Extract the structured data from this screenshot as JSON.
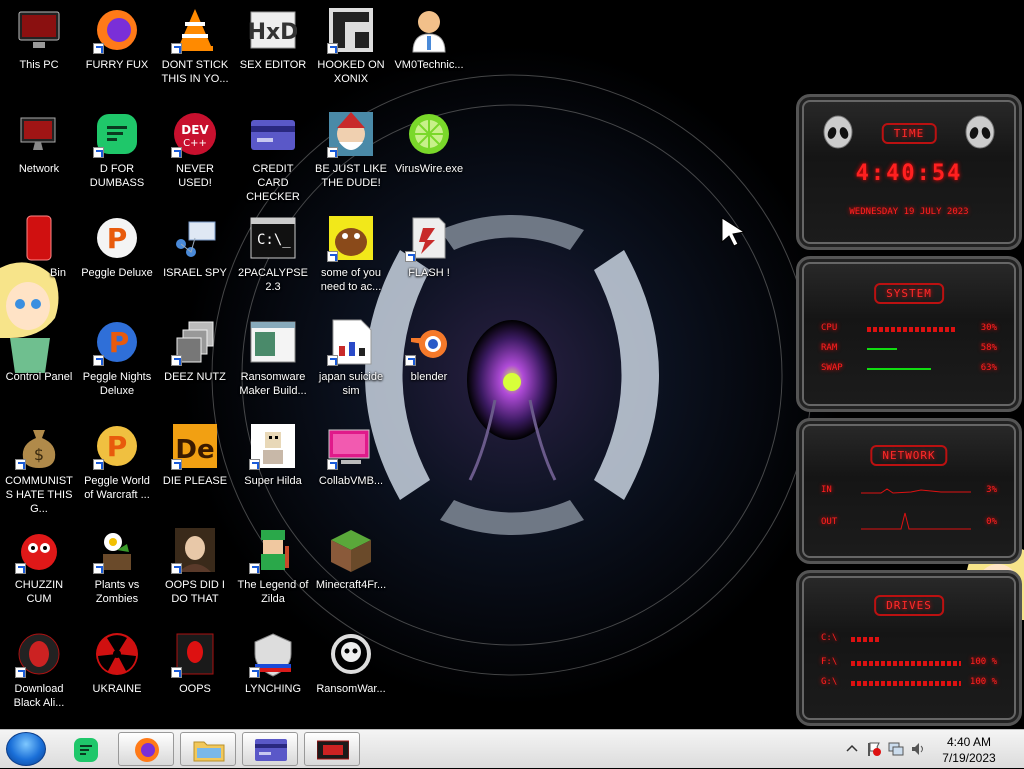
{
  "desktop": {
    "icons": [
      {
        "label": "This PC",
        "icon": "computer-icon"
      },
      {
        "label": "Network",
        "icon": "network-icon"
      },
      {
        "label": "Bin",
        "icon": "recycle-bin-icon"
      },
      {
        "label": "Control Panel",
        "icon": "control-panel-icon"
      },
      {
        "label": "COMMUNISTS HATE THIS G...",
        "icon": "money-bag-icon"
      },
      {
        "label": "CHUZZIN CUM",
        "icon": "chuzzle-icon"
      },
      {
        "label": "Download Black Ali...",
        "icon": "alien-icon"
      },
      {
        "label": "FURRY FUX",
        "icon": "firefox-icon"
      },
      {
        "label": "D FOR DUMBASS",
        "icon": "chat-app-icon"
      },
      {
        "label": "Peggle Deluxe",
        "icon": "peggle-icon"
      },
      {
        "label": "Peggle Nights Deluxe",
        "icon": "peggle-nights-icon"
      },
      {
        "label": "Peggle World of Warcraft ...",
        "icon": "peggle-wow-icon"
      },
      {
        "label": "Plants vs Zombies",
        "icon": "plants-icon"
      },
      {
        "label": "UKRAINE",
        "icon": "radiation-icon"
      },
      {
        "label": "DONT STICK THIS IN YO...",
        "icon": "vlc-icon"
      },
      {
        "label": "NEVER USED!",
        "icon": "dev-cpp-icon"
      },
      {
        "label": "ISRAEL SPY",
        "icon": "network-share-icon"
      },
      {
        "label": "DEEZ NUTZ",
        "icon": "windows-stack-icon"
      },
      {
        "label": "DIE PLEASE",
        "icon": "de-icon"
      },
      {
        "label": "OOPS DID I DO THAT",
        "icon": "portrait-icon"
      },
      {
        "label": "OOPS",
        "icon": "alienware-icon"
      },
      {
        "label": "SEX EDITOR",
        "icon": "hxd-icon"
      },
      {
        "label": "CREDIT CARD CHECKER",
        "icon": "credit-card-icon"
      },
      {
        "label": "2PACALYPSE 2.3",
        "icon": "terminal-icon"
      },
      {
        "label": "Ransomware Maker Build...",
        "icon": "app-window-icon"
      },
      {
        "label": "Super Hilda",
        "icon": "pixel-art-icon"
      },
      {
        "label": "The Legend of Zilda",
        "icon": "zelda-icon"
      },
      {
        "label": "LYNCHING",
        "icon": "bell-shield-icon"
      },
      {
        "label": "HOOKED ON XONIX",
        "icon": "xonix-icon"
      },
      {
        "label": "BE JUST LIKE THE DUDE!",
        "icon": "elf-icon"
      },
      {
        "label": "some of you need to ac...",
        "icon": "beaver-icon"
      },
      {
        "label": "japan suicide sim",
        "icon": "document-icon"
      },
      {
        "label": "CollabVMB...",
        "icon": "collabvm-icon"
      },
      {
        "label": "Minecraft4Fr...",
        "icon": "minecraft-icon"
      },
      {
        "label": "RansomWar...",
        "icon": "skull-icon"
      },
      {
        "label": "VM0Technic...",
        "icon": "doctor-icon"
      },
      {
        "label": "VirusWire.exe",
        "icon": "limewire-icon"
      },
      {
        "label": "FLASH !",
        "icon": "flash-icon"
      },
      {
        "label": "blender",
        "icon": "blender-icon"
      }
    ]
  },
  "widgets": {
    "time": {
      "title": "TIME",
      "clock": "4:40:54",
      "date": "WEDNESDAY 19 JULY 2023"
    },
    "system": {
      "title": "SYSTEM",
      "rows": [
        {
          "key": "CPU",
          "value": "30%",
          "level": 0.9
        },
        {
          "key": "RAM",
          "value": "58%",
          "level": 0.58
        },
        {
          "key": "SWAP",
          "value": "63%",
          "level": 0.63
        }
      ]
    },
    "network": {
      "title": "NETWORK",
      "rows": [
        {
          "key": "IN",
          "value": "3%"
        },
        {
          "key": "OUT",
          "value": "0%"
        }
      ]
    },
    "drives": {
      "title": "DRIVES",
      "rows": [
        {
          "key": "C:\\",
          "value": ""
        },
        {
          "key": "F:\\",
          "value": "100 %"
        },
        {
          "key": "G:\\",
          "value": "100 %"
        }
      ]
    }
  },
  "taskbar": {
    "items": [
      {
        "name": "D FOR DUMBASS",
        "icon": "chat-app-icon"
      },
      {
        "name": "FURRY FUX",
        "icon": "firefox-icon"
      },
      {
        "name": "File Explorer",
        "icon": "folder-icon"
      },
      {
        "name": "CREDIT CARD CHECKER",
        "icon": "credit-card-icon"
      },
      {
        "name": "OOPS",
        "icon": "alienware-icon"
      }
    ],
    "clock": {
      "time": "4:40 AM",
      "date": "7/19/2023"
    }
  },
  "colors": {
    "accent_red": "#ff2020",
    "taskbar_bg": "#e6e6e6"
  }
}
